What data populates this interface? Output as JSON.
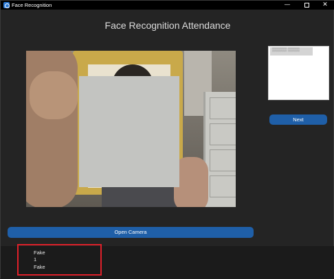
{
  "window": {
    "title": "Face Recognition",
    "controls": {
      "minimize": "—",
      "close": "✕"
    }
  },
  "main": {
    "heading": "Face Recognition Attendance",
    "camera": {
      "face_mask_color": "#c3c4c1"
    },
    "side_panel": {
      "name_label": "▒▒▒▒▒ ▒▒▒▒"
    },
    "next_button": "Next",
    "open_camera_button": "Open Camera"
  },
  "output": {
    "lines": [
      "Fake",
      "1",
      "Fake"
    ],
    "highlight_color": "#e0202a"
  },
  "colors": {
    "background": "#242424",
    "button": "#1f5fa8",
    "titlebar": "#000000"
  }
}
